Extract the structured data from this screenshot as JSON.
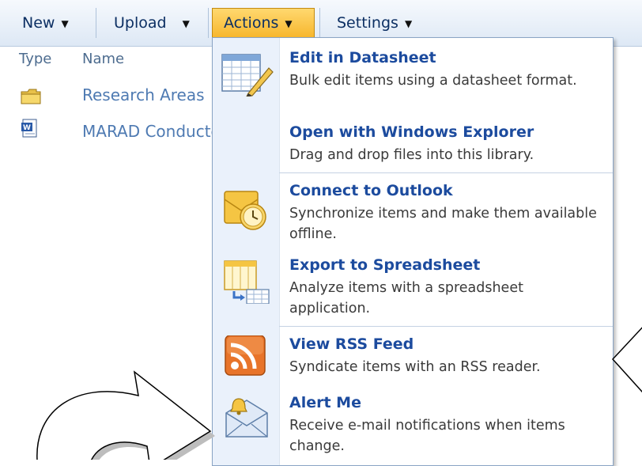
{
  "toolbar": {
    "new_label": "New",
    "upload_label": "Upload",
    "actions_label": "Actions",
    "settings_label": "Settings"
  },
  "list": {
    "columns": {
      "type": "Type",
      "name": "Name"
    },
    "rows": [
      {
        "icon": "folder-icon",
        "name": "Research Areas"
      },
      {
        "icon": "word-document-icon",
        "name": "MARAD Conducted Research"
      }
    ]
  },
  "actions_menu": {
    "items": [
      {
        "icon": "datasheet-icon",
        "title": "Edit in Datasheet",
        "description": "Bulk edit items using a datasheet format."
      },
      {
        "icon": "explorer-icon",
        "title": "Open with Windows Explorer",
        "description": "Drag and drop files into this library."
      },
      {
        "icon": "outlook-icon",
        "title": "Connect to Outlook",
        "description": "Synchronize items and make them available offline."
      },
      {
        "icon": "spreadsheet-export-icon",
        "title": "Export to Spreadsheet",
        "description": "Analyze items with a spreadsheet application."
      },
      {
        "icon": "rss-icon",
        "title": "View RSS Feed",
        "description": "Syndicate items with an RSS reader."
      },
      {
        "icon": "alert-bell-icon",
        "title": "Alert Me",
        "description": "Receive e-mail notifications when items change."
      }
    ]
  },
  "colors": {
    "toolbar_text": "#0c2f63",
    "active_button": "#f7b72e",
    "menu_title": "#1c4b9e",
    "menu_gutter": "#eaf1fb"
  }
}
